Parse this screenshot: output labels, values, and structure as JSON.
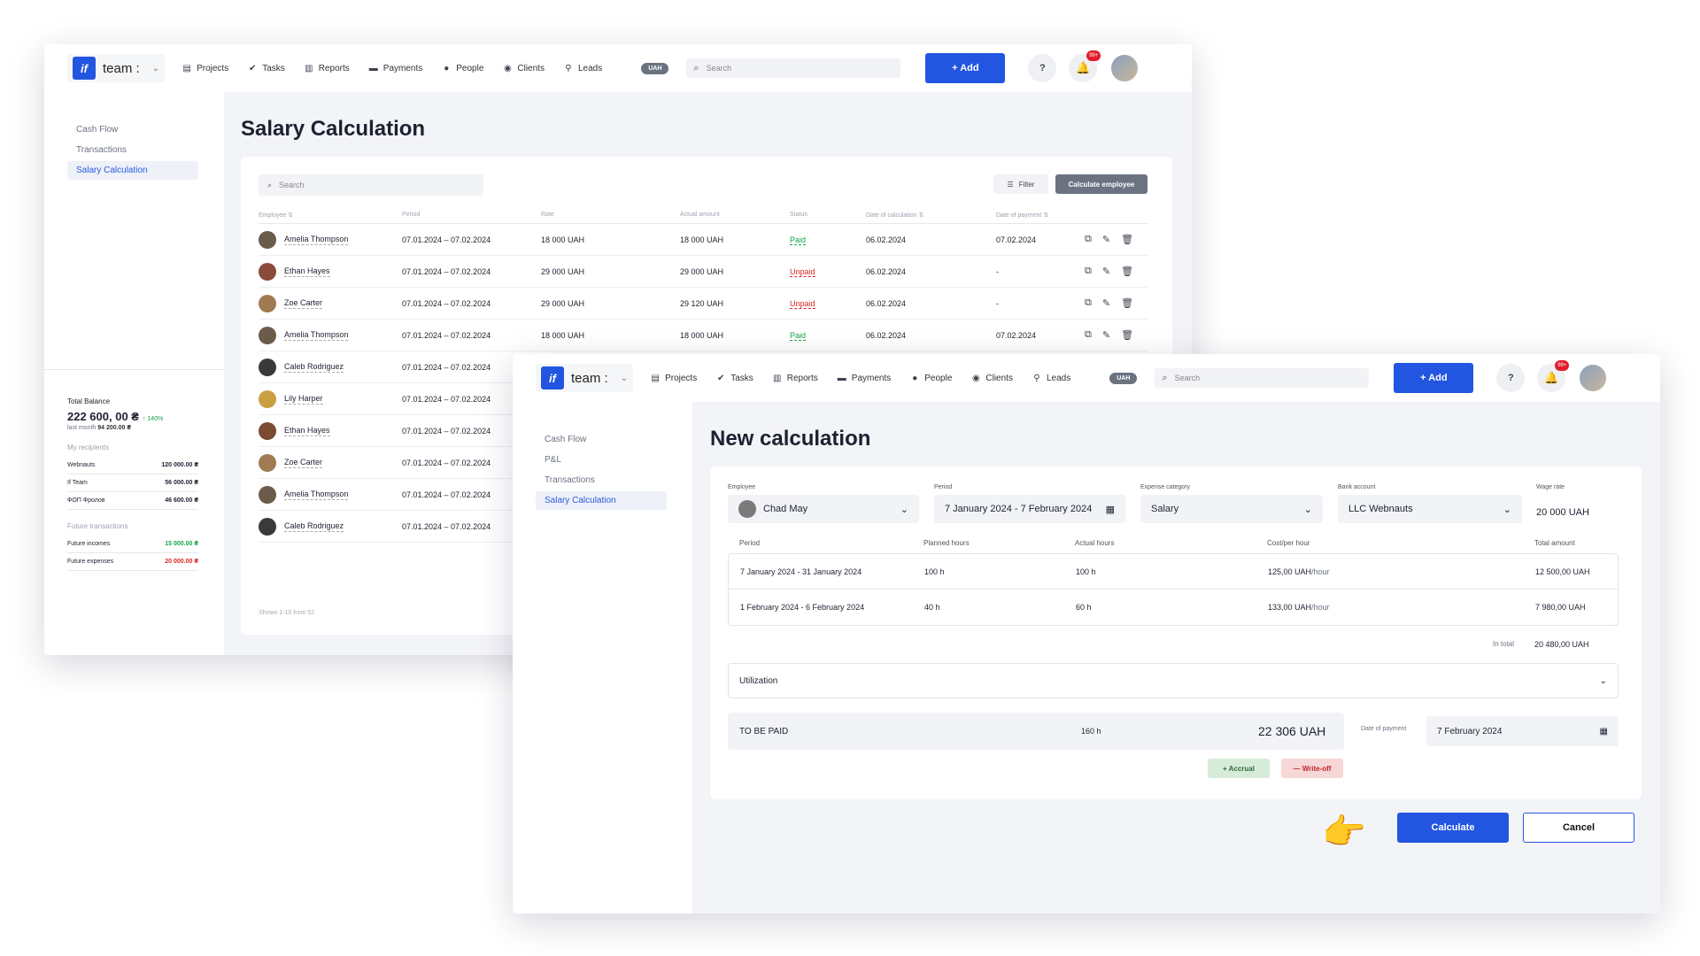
{
  "nav": {
    "brand": "team :",
    "brand_mark": "if",
    "items": [
      {
        "label": "Projects",
        "icon": "document-icon"
      },
      {
        "label": "Tasks",
        "icon": "check-circle-icon"
      },
      {
        "label": "Reports",
        "icon": "report-icon"
      },
      {
        "label": "Payments",
        "icon": "card-icon"
      },
      {
        "label": "People",
        "icon": "person-icon"
      },
      {
        "label": "Clients",
        "icon": "clients-icon"
      },
      {
        "label": "Leads",
        "icon": "leads-icon"
      }
    ],
    "currency": "UAH",
    "search_placeholder": "Search",
    "add_label": "+ Add",
    "help_icon": "?",
    "notif_badge": "99+"
  },
  "win1": {
    "sidebar": [
      "Cash Flow",
      "Transactions",
      "Salary Calculation"
    ],
    "balance": {
      "title": "Total Balance",
      "amount": "222 600, 00 ₴",
      "change": "↑ 140%",
      "last_month_label": "last month",
      "last_month_value": "94 200.00 ₴",
      "recipients_title": "My recipients",
      "recipients": [
        {
          "name": "Webnauts",
          "value": "120 000.00 ₴"
        },
        {
          "name": "If Team",
          "value": "56 000.00 ₴"
        },
        {
          "name": "ФОП Фролов",
          "value": "46 600.00 ₴"
        }
      ],
      "future_title": "Future transactions",
      "future": [
        {
          "name": "Future incomes",
          "value": "15 000.00 ₴"
        },
        {
          "name": "Future expenses",
          "value": "20 000.00 ₴"
        }
      ]
    },
    "page_title": "Salary Calculation",
    "search_placeholder": "Search",
    "filter_label": "Filter",
    "calc_employee_label": "Calculate employee",
    "columns": [
      "Employee",
      "Period",
      "Rate",
      "Actual amount",
      "Status",
      "Date of calculation",
      "Date of payment"
    ],
    "rows": [
      {
        "name": "Amelia Thompson",
        "period": "07.01.2024 – 07.02.2024",
        "rate": "18 000 UAH",
        "actual": "18 000 UAH",
        "status": "Paid",
        "calc": "06.02.2024",
        "paid": "07.02.2024"
      },
      {
        "name": "Ethan Hayes",
        "period": "07.01.2024 – 07.02.2024",
        "rate": "29 000 UAH",
        "actual": "29 000 UAH",
        "status": "Unpaid",
        "calc": "06.02.2024",
        "paid": "-"
      },
      {
        "name": "Zoe Carter",
        "period": "07.01.2024 – 07.02.2024",
        "rate": "29 000 UAH",
        "actual": "29 120 UAH",
        "status": "Unpaid",
        "calc": "06.02.2024",
        "paid": "-"
      },
      {
        "name": "Amelia Thompson",
        "period": "07.01.2024 – 07.02.2024",
        "rate": "18 000 UAH",
        "actual": "18 000 UAH",
        "status": "Paid",
        "calc": "06.02.2024",
        "paid": "07.02.2024"
      },
      {
        "name": "Caleb Rodriguez",
        "period": "07.01.2024 – 07.02.2024"
      },
      {
        "name": "Lily Harper",
        "period": "07.01.2024 – 07.02.2024"
      },
      {
        "name": "Ethan Hayes",
        "period": "07.01.2024 – 07.02.2024"
      },
      {
        "name": "Zoe Carter",
        "period": "07.01.2024 – 07.02.2024"
      },
      {
        "name": "Amelia Thompson",
        "period": "07.01.2024 – 07.02.2024"
      },
      {
        "name": "Caleb Rodriguez",
        "period": "07.01.2024 – 07.02.2024"
      }
    ],
    "shown": "Shown 1-10 from 52"
  },
  "win2": {
    "sidebar": [
      "Cash Flow",
      "P&L",
      "Transactions",
      "Salary Calculation"
    ],
    "page_title": "New calculation",
    "fields": {
      "employee_label": "Employee",
      "employee": "Chad May",
      "period_label": "Period",
      "period": "7 January 2024 - 7 February 2024",
      "category_label": "Expense category",
      "category": "Salary",
      "bank_label": "Bank account",
      "bank": "LLC Webnauts",
      "wage_label": "Wage rate",
      "wage": "20 000 UAH"
    },
    "columns": [
      "Period",
      "Planned hours",
      "Actual hours",
      "Cost/per hour",
      "Total amount"
    ],
    "rows": [
      {
        "period": "7 January 2024 - 31 January 2024",
        "planned": "100 h",
        "actual": "100 h",
        "cost": "125,00 UAH",
        "unit": "/hour",
        "total": "12 500,00 UAH"
      },
      {
        "period": "1 February 2024 - 6 February 2024",
        "planned": "40 h",
        "actual": "60 h",
        "cost": "133,00 UAH",
        "unit": "/hour",
        "total": "7 980,00 UAH"
      }
    ],
    "in_total_label": "In total",
    "in_total": "20 480,00 UAH",
    "utilization": "Utilization",
    "to_be_paid_label": "TO BE PAID",
    "to_be_paid_hours": "160 h",
    "to_be_paid_amount": "22 306 UAH",
    "date_payment_label": "Date of payment",
    "date_payment": "7 February 2024",
    "accrual": "+ Accrual",
    "writeoff": "— Write-off",
    "calculate": "Calculate",
    "cancel": "Cancel",
    "pointer": "👉"
  }
}
